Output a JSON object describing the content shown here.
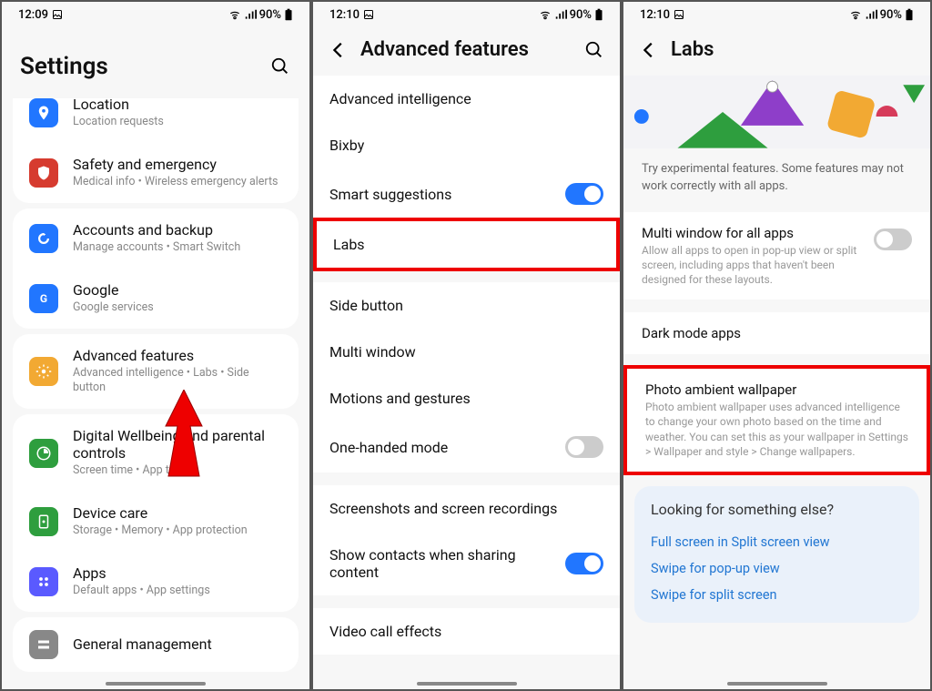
{
  "screen1": {
    "status": {
      "time": "12:09",
      "battery": "90%"
    },
    "title": "Settings",
    "groups": [
      [
        {
          "icon": "location",
          "color": "#2176ff",
          "title": "Location",
          "sub": "Location requests"
        },
        {
          "icon": "safety",
          "color": "#d63b2f",
          "title": "Safety and emergency",
          "sub": "Medical info  •  Wireless emergency alerts"
        }
      ],
      [
        {
          "icon": "accounts",
          "color": "#2176ff",
          "title": "Accounts and backup",
          "sub": "Manage accounts  •  Smart Switch"
        },
        {
          "icon": "google",
          "color": "#2176ff",
          "title": "Google",
          "sub": "Google services"
        }
      ],
      [
        {
          "icon": "advanced",
          "color": "#f2a933",
          "title": "Advanced features",
          "sub": "Advanced intelligence  •  Labs  •  Side button"
        }
      ],
      [
        {
          "icon": "wellbeing",
          "color": "#2e9e3e",
          "title": "Digital Wellbeing and parental controls",
          "sub": "Screen time  •  App timers"
        },
        {
          "icon": "device",
          "color": "#2e9e3e",
          "title": "Device care",
          "sub": "Storage  •  Memory  •  App protection"
        },
        {
          "icon": "apps",
          "color": "#5a5aff",
          "title": "Apps",
          "sub": "Default apps  •  App settings"
        }
      ],
      [
        {
          "icon": "general",
          "color": "#888",
          "title": "General management",
          "sub": ""
        }
      ]
    ]
  },
  "screen2": {
    "status": {
      "time": "12:10",
      "battery": "90%"
    },
    "title": "Advanced features",
    "sections": [
      [
        {
          "title": "Advanced intelligence"
        },
        {
          "title": "Bixby"
        },
        {
          "title": "Smart suggestions",
          "toggle": "on"
        }
      ],
      [
        {
          "title": "Labs",
          "highlight": true
        }
      ],
      [
        {
          "title": "Side button"
        },
        {
          "title": "Multi window"
        },
        {
          "title": "Motions and gestures"
        },
        {
          "title": "One-handed mode",
          "toggle": "off"
        }
      ],
      [
        {
          "title": "Screenshots and screen recordings"
        },
        {
          "title": "Show contacts when sharing content",
          "toggle": "on"
        }
      ],
      [
        {
          "title": "Video call effects"
        }
      ]
    ]
  },
  "screen3": {
    "status": {
      "time": "12:10",
      "battery": "90%"
    },
    "title": "Labs",
    "intro": "Try experimental features. Some features may not work correctly with all apps.",
    "items": [
      {
        "title": "Multi window for all apps",
        "sub": "Allow all apps to open in pop-up view or split screen, including apps that haven't been designed for these layouts.",
        "toggle": "off"
      },
      {
        "title": "Dark mode apps"
      },
      {
        "title": "Photo ambient wallpaper",
        "sub": "Photo ambient wallpaper uses advanced intelligence to change your own photo based on the time and weather. You can set this as your wallpaper in Settings > Wallpaper and style > Change wallpapers.",
        "highlight": true
      }
    ],
    "looking": {
      "title": "Looking for something else?",
      "links": [
        "Full screen in Split screen view",
        "Swipe for pop-up view",
        "Swipe for split screen"
      ]
    }
  }
}
